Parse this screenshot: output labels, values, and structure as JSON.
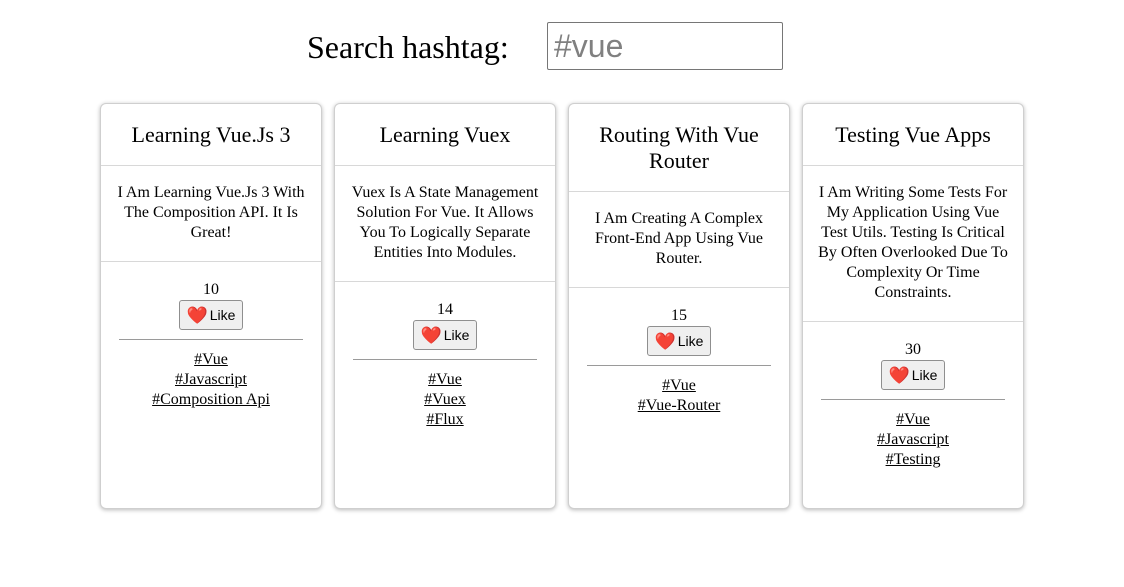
{
  "search": {
    "label": "Search hashtag:",
    "placeholder": "#vue"
  },
  "like_icon_name": "heart-icon",
  "like_icon_glyph": "❤️",
  "cards": [
    {
      "title": "Learning Vue.Js 3",
      "content": "I Am Learning Vue.Js 3 With The Composition API. It Is Great!",
      "likes": "10",
      "like_label": "Like",
      "hashtags": [
        "#Vue",
        "#Javascript",
        "#Composition Api"
      ]
    },
    {
      "title": "Learning Vuex",
      "content": "Vuex Is A State Management Solution For Vue. It Allows You To Logically Separate Entities Into Modules.",
      "likes": "14",
      "like_label": "Like",
      "hashtags": [
        "#Vue",
        "#Vuex",
        "#Flux"
      ]
    },
    {
      "title": "Routing With Vue Router",
      "content": "I Am Creating A Complex Front-End App Using Vue Router.",
      "likes": "15",
      "like_label": "Like",
      "hashtags": [
        "#Vue",
        "#Vue-Router"
      ]
    },
    {
      "title": "Testing Vue Apps",
      "content": "I Am Writing Some Tests For My Application Using Vue Test Utils. Testing Is Critical By Often Overlooked Due To Complexity Or Time Constraints.",
      "likes": "30",
      "like_label": "Like",
      "hashtags": [
        "#Vue",
        "#Javascript",
        "#Testing"
      ]
    }
  ]
}
